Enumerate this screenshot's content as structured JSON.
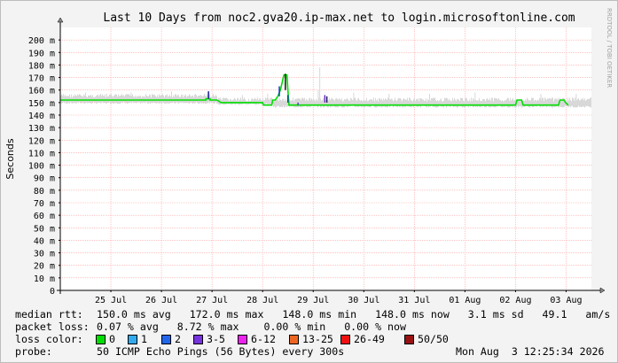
{
  "title": "Last 10 Days from noc2.gva20.ip-max.net to login.microsoftonline.com",
  "watermark": "RRDTOOL / TOBI OETIKER",
  "chart_data": {
    "type": "line",
    "title": "Last 10 Days from noc2.gva20.ip-max.net to login.microsoftonline.com",
    "ylabel": "Seconds",
    "xlabel": "",
    "ylim": [
      0,
      210
    ],
    "yticks": [
      0,
      10,
      20,
      30,
      40,
      50,
      60,
      70,
      80,
      90,
      100,
      110,
      120,
      130,
      140,
      150,
      160,
      170,
      180,
      190,
      200
    ],
    "ytick_unit": "m",
    "xlim": [
      0,
      10.5
    ],
    "xticks": [
      {
        "x": 1,
        "label": "25 Jul"
      },
      {
        "x": 2,
        "label": "26 Jul"
      },
      {
        "x": 3,
        "label": "27 Jul"
      },
      {
        "x": 4,
        "label": "28 Jul"
      },
      {
        "x": 5,
        "label": "29 Jul"
      },
      {
        "x": 6,
        "label": "30 Jul"
      },
      {
        "x": 7,
        "label": "31 Jul"
      },
      {
        "x": 8,
        "label": "01 Aug"
      },
      {
        "x": 9,
        "label": "02 Aug"
      },
      {
        "x": 10,
        "label": "03 Aug"
      }
    ],
    "grid": true,
    "series": [
      {
        "name": "0",
        "color": "#00dd00",
        "points": [
          [
            0,
            152
          ],
          [
            2.88,
            152
          ],
          [
            2.88,
            153
          ],
          [
            2.96,
            153
          ],
          [
            2.96,
            152
          ],
          [
            3.1,
            152
          ],
          [
            3.18,
            150
          ],
          [
            4.0,
            150
          ],
          [
            4.02,
            148
          ],
          [
            4.18,
            148
          ],
          [
            4.2,
            152
          ],
          [
            4.25,
            152
          ],
          [
            4.3,
            155
          ],
          [
            4.35,
            160
          ],
          [
            4.38,
            165
          ],
          [
            4.42,
            172
          ],
          [
            4.48,
            172
          ],
          [
            4.5,
            160
          ],
          [
            4.52,
            148
          ],
          [
            5.7,
            148
          ],
          [
            5.9,
            148
          ],
          [
            9.0,
            148
          ],
          [
            9.03,
            152
          ],
          [
            9.12,
            152
          ],
          [
            9.15,
            148
          ],
          [
            9.85,
            148
          ],
          [
            9.88,
            152
          ],
          [
            9.96,
            152
          ],
          [
            9.99,
            150
          ],
          [
            10.04,
            148
          ]
        ]
      }
    ],
    "spikes": [
      {
        "x": 2.93,
        "lo": 153,
        "hi": 159,
        "color": "#0a0a8a"
      },
      {
        "x": 4.33,
        "lo": 155,
        "hi": 163,
        "color": "#2020e0"
      },
      {
        "x": 4.45,
        "lo": 160,
        "hi": 173,
        "color": "#000000"
      },
      {
        "x": 4.5,
        "lo": 150,
        "hi": 156,
        "color": "#2020e0"
      },
      {
        "x": 4.7,
        "lo": 148,
        "hi": 150,
        "color": "#5030c0"
      },
      {
        "x": 5.23,
        "lo": 150,
        "hi": 156,
        "color": "#7020c0"
      },
      {
        "x": 5.27,
        "lo": 150,
        "hi": 155,
        "color": "#101060"
      }
    ],
    "smoke": {
      "color": "#d8d8d8",
      "bands": [
        {
          "x0": 0,
          "x1": 3.1,
          "lo": 149,
          "hi": 157
        },
        {
          "x0": 3.1,
          "x1": 4.2,
          "lo": 148,
          "hi": 154
        },
        {
          "x0": 4.2,
          "x1": 10.5,
          "lo": 146,
          "hi": 154
        }
      ],
      "peaks": [
        [
          0.5,
          158
        ],
        [
          1.4,
          158
        ],
        [
          2.2,
          159
        ],
        [
          3.6,
          156
        ],
        [
          4.1,
          157
        ],
        [
          5.1,
          160
        ],
        [
          5.13,
          178
        ],
        [
          5.8,
          158
        ],
        [
          6.5,
          157
        ],
        [
          7.3,
          157
        ],
        [
          8.2,
          158
        ],
        [
          9.5,
          157
        ],
        [
          10.2,
          157
        ]
      ]
    }
  },
  "footer": {
    "rows": [
      {
        "key": "median rtt:",
        "value": "150.0 ms avg   172.0 ms max   148.0 ms min   148.0 ms now   3.1 ms sd   49.1   am/s"
      },
      {
        "key": "packet loss:",
        "value": "0.07 % avg   8.72 % max    0.00 % min   0.00 % now"
      }
    ],
    "loss_color_label": "loss color:",
    "loss_legend": [
      {
        "label": "0",
        "color": "#00dd00"
      },
      {
        "label": "1",
        "color": "#33aaee"
      },
      {
        "label": "2",
        "color": "#2266ee"
      },
      {
        "label": "3-5",
        "color": "#7733dd"
      },
      {
        "label": "6-12",
        "color": "#ee22ee"
      },
      {
        "label": "13-25",
        "color": "#ee6622"
      },
      {
        "label": "26-49",
        "color": "#ee1111"
      },
      {
        "label": "50/50",
        "color": "#991111"
      }
    ],
    "probe_label": "probe:",
    "probe_value": "50 ICMP Echo Pings (56 Bytes) every 300s",
    "timestamp": "Mon Aug  3 12:25:34 2026"
  }
}
